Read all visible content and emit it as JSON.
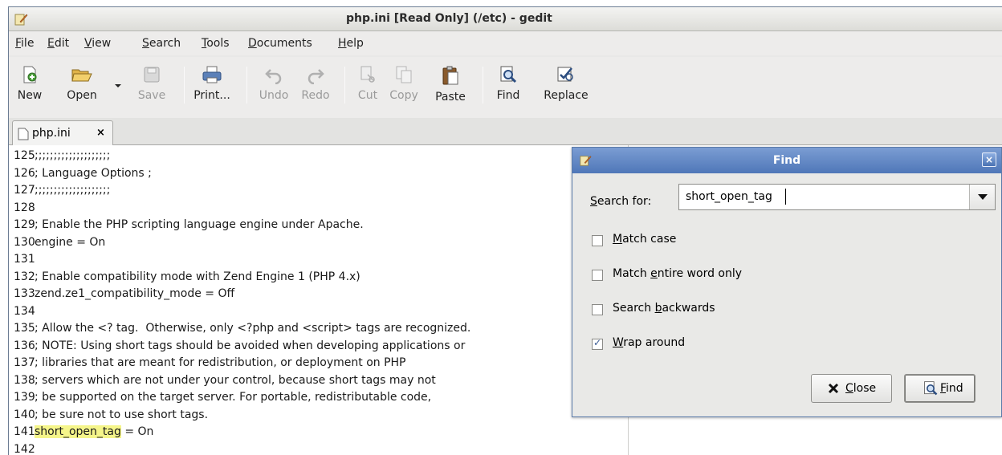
{
  "window": {
    "title": "php.ini [Read Only] (/etc) - gedit"
  },
  "menubar": {
    "items": [
      {
        "pre": "",
        "u": "F",
        "post": "ile"
      },
      {
        "pre": "",
        "u": "E",
        "post": "dit"
      },
      {
        "pre": "",
        "u": "V",
        "post": "iew"
      },
      {
        "pre": "",
        "u": "S",
        "post": "earch"
      },
      {
        "pre": "",
        "u": "T",
        "post": "ools"
      },
      {
        "pre": "",
        "u": "D",
        "post": "ocuments"
      },
      {
        "pre": "",
        "u": "H",
        "post": "elp"
      }
    ]
  },
  "toolbar": {
    "new": "New",
    "open": "Open",
    "save": "Save",
    "print": "Print...",
    "undo": "Undo",
    "redo": "Redo",
    "cut": "Cut",
    "copy": "Copy",
    "paste": "Paste",
    "find": "Find",
    "replace": "Replace"
  },
  "tab": {
    "label": "php.ini",
    "close": "×"
  },
  "editor": {
    "lines": [
      {
        "n": "125",
        "text": ";;;;;;;;;;;;;;;;;;;;"
      },
      {
        "n": "126",
        "text": "; Language Options ;"
      },
      {
        "n": "127",
        "text": ";;;;;;;;;;;;;;;;;;;;"
      },
      {
        "n": "128",
        "text": ""
      },
      {
        "n": "129",
        "text": "; Enable the PHP scripting language engine under Apache."
      },
      {
        "n": "130",
        "text": "engine = On"
      },
      {
        "n": "131",
        "text": ""
      },
      {
        "n": "132",
        "text": "; Enable compatibility mode with Zend Engine 1 (PHP 4.x)"
      },
      {
        "n": "133",
        "text": "zend.ze1_compatibility_mode = Off"
      },
      {
        "n": "134",
        "text": ""
      },
      {
        "n": "135",
        "text": "; Allow the <? tag.  Otherwise, only <?php and <script> tags are recognized."
      },
      {
        "n": "136",
        "text": "; NOTE: Using short tags should be avoided when developing applications or"
      },
      {
        "n": "137",
        "text": "; libraries that are meant for redistribution, or deployment on PHP"
      },
      {
        "n": "138",
        "text": "; servers which are not under your control, because short tags may not"
      },
      {
        "n": "139",
        "text": "; be supported on the target server. For portable, redistributable code,"
      },
      {
        "n": "140",
        "text": "; be sure not to use short tags."
      },
      {
        "n": "141",
        "hl": "short_open_tag",
        "text": " = On"
      },
      {
        "n": "142",
        "text": ""
      }
    ]
  },
  "find_dialog": {
    "title": "Find",
    "close_glyph": "×",
    "search_label_u": "S",
    "search_label_rest": "earch for:",
    "search_value": "short_open_tag",
    "options": [
      {
        "pre": "",
        "u": "M",
        "post": "atch case",
        "checked": false
      },
      {
        "pre": "Match ",
        "u": "e",
        "post": "ntire word only",
        "checked": false
      },
      {
        "pre": "Search ",
        "u": "b",
        "post": "ackwards",
        "checked": false
      },
      {
        "pre": "",
        "u": "W",
        "post": "rap around",
        "checked": true
      }
    ],
    "close_button": {
      "pre": "",
      "u": "C",
      "post": "lose"
    },
    "find_button": {
      "pre": "",
      "u": "F",
      "post": "ind"
    }
  }
}
